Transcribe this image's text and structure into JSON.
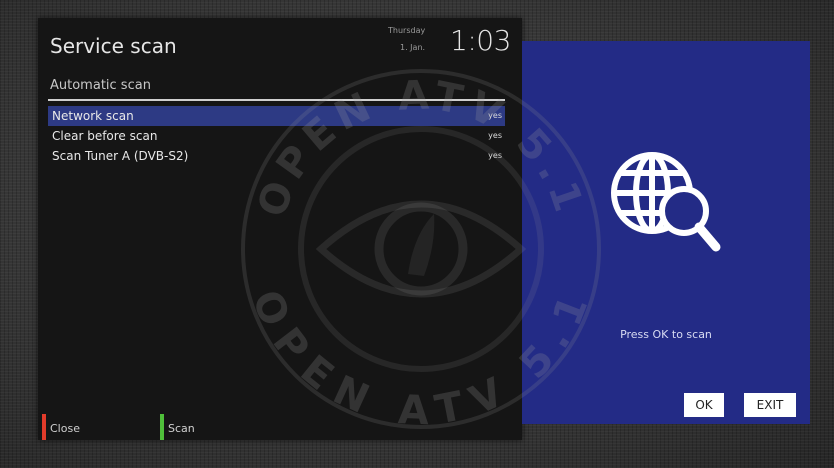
{
  "main": {
    "title": "Service scan",
    "clock_day": "Thursday",
    "clock_date": "1. Jan.",
    "clock_time": "1:03",
    "subtitle": "Automatic scan",
    "items": [
      {
        "label": "Network scan",
        "value": "yes",
        "selected": true
      },
      {
        "label": "Clear before scan",
        "value": "yes",
        "selected": false
      },
      {
        "label": "Scan Tuner A (DVB-S2)",
        "value": "yes",
        "selected": false
      }
    ]
  },
  "buttons": {
    "red_label": "Close",
    "green_label": "Scan",
    "red_color": "#e23b2a",
    "green_color": "#4fbf3a"
  },
  "info": {
    "icon": "globe-search-icon",
    "hint": "Press OK to scan",
    "ok_label": "OK",
    "exit_label": "EXIT"
  },
  "colors": {
    "panel_bg": "#151515",
    "highlight": "#2d3a84",
    "info_bg": "#232b86"
  },
  "watermark": {
    "text": "OPEN ATV 5.1"
  }
}
